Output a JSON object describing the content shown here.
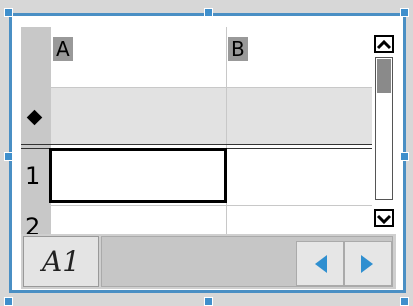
{
  "spreadsheet": {
    "columns": [
      {
        "label": "A"
      },
      {
        "label": "B"
      }
    ],
    "rows": [
      {
        "label": "1"
      },
      {
        "label": "2"
      }
    ],
    "formula_row_icon": "diamond-icon",
    "selected_cell": "A1"
  },
  "scrollbar": {
    "up_icon": "arrow-up-icon",
    "down_icon": "arrow-down-icon"
  },
  "navigation": {
    "cell_reference": "A1",
    "prev_icon": "arrow-left-icon",
    "next_icon": "arrow-right-icon"
  },
  "colors": {
    "frame_border": "#4a8fc4",
    "handle": "#3f8fcc",
    "nav_arrow": "#2f8fd0",
    "header_fill": "#999999"
  }
}
